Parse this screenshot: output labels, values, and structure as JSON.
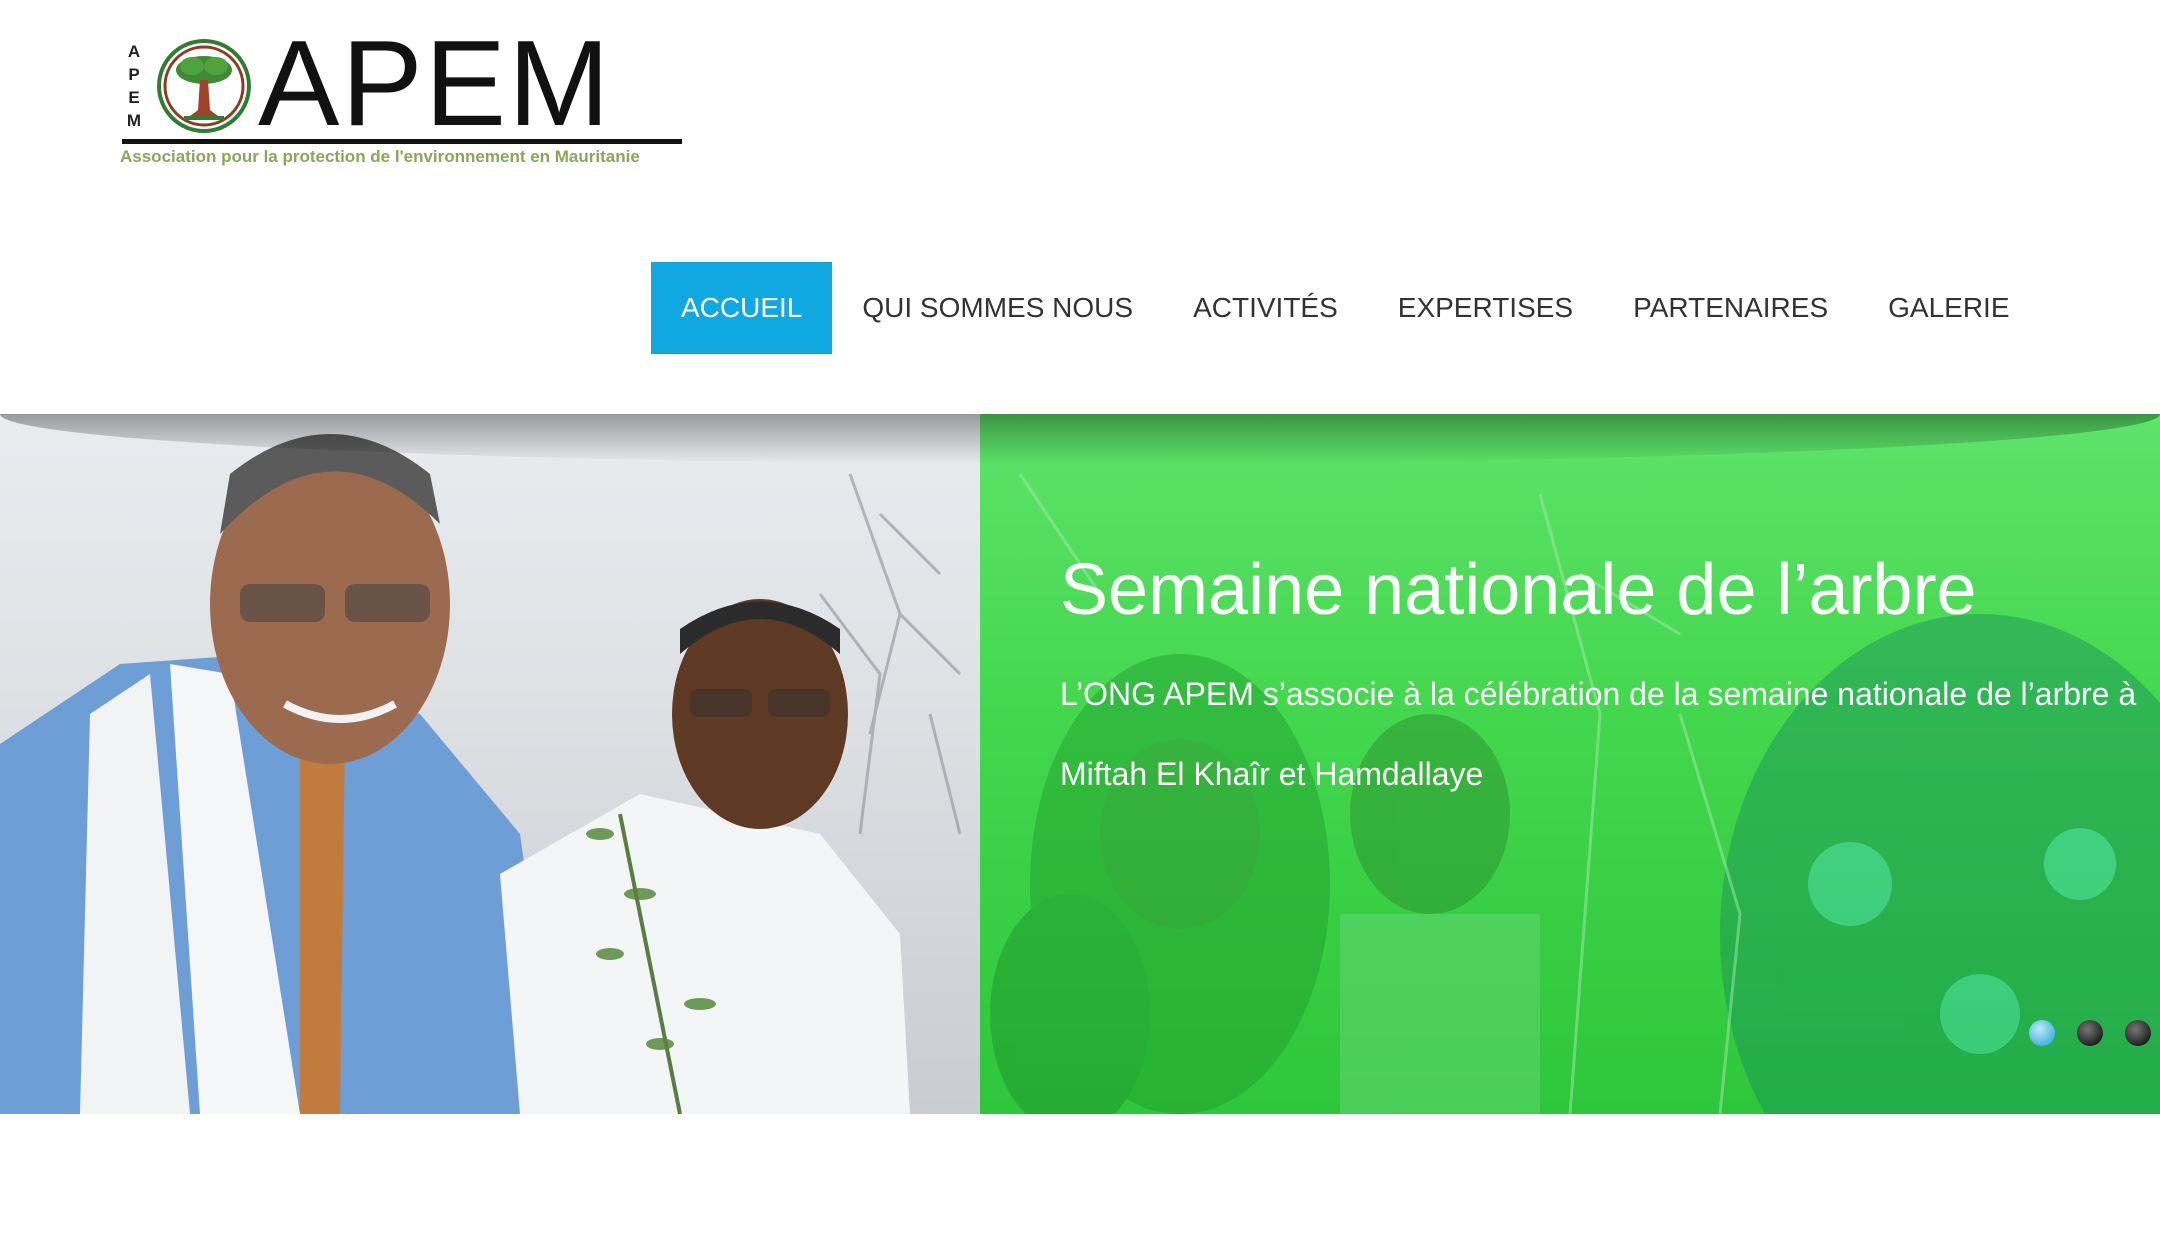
{
  "logo": {
    "vertical_letters": [
      "A",
      "P",
      "E",
      "M"
    ],
    "wordmark": "APEM",
    "tagline": "Association pour la protection de l'environnement en Mauritanie"
  },
  "nav": {
    "items": [
      {
        "label": "ACCUEIL",
        "active": true
      },
      {
        "label": "QUI SOMMES NOUS",
        "active": false
      },
      {
        "label": "ACTIVITÉS",
        "active": false
      },
      {
        "label": "EXPERTISES",
        "active": false
      },
      {
        "label": "PARTENAIRES",
        "active": false
      },
      {
        "label": "GALERIE",
        "active": false
      }
    ],
    "active_color": "#0fa8e0"
  },
  "hero": {
    "title": "Semaine nationale de l’arbre",
    "caption": "L’ONG APEM s’associe à la célébration de la semaine nationale de l’arbre à Miftah El Khaîr et Hamdallaye",
    "overlay_color": "#44d84f",
    "slide_count": 3,
    "active_slide": 1
  }
}
